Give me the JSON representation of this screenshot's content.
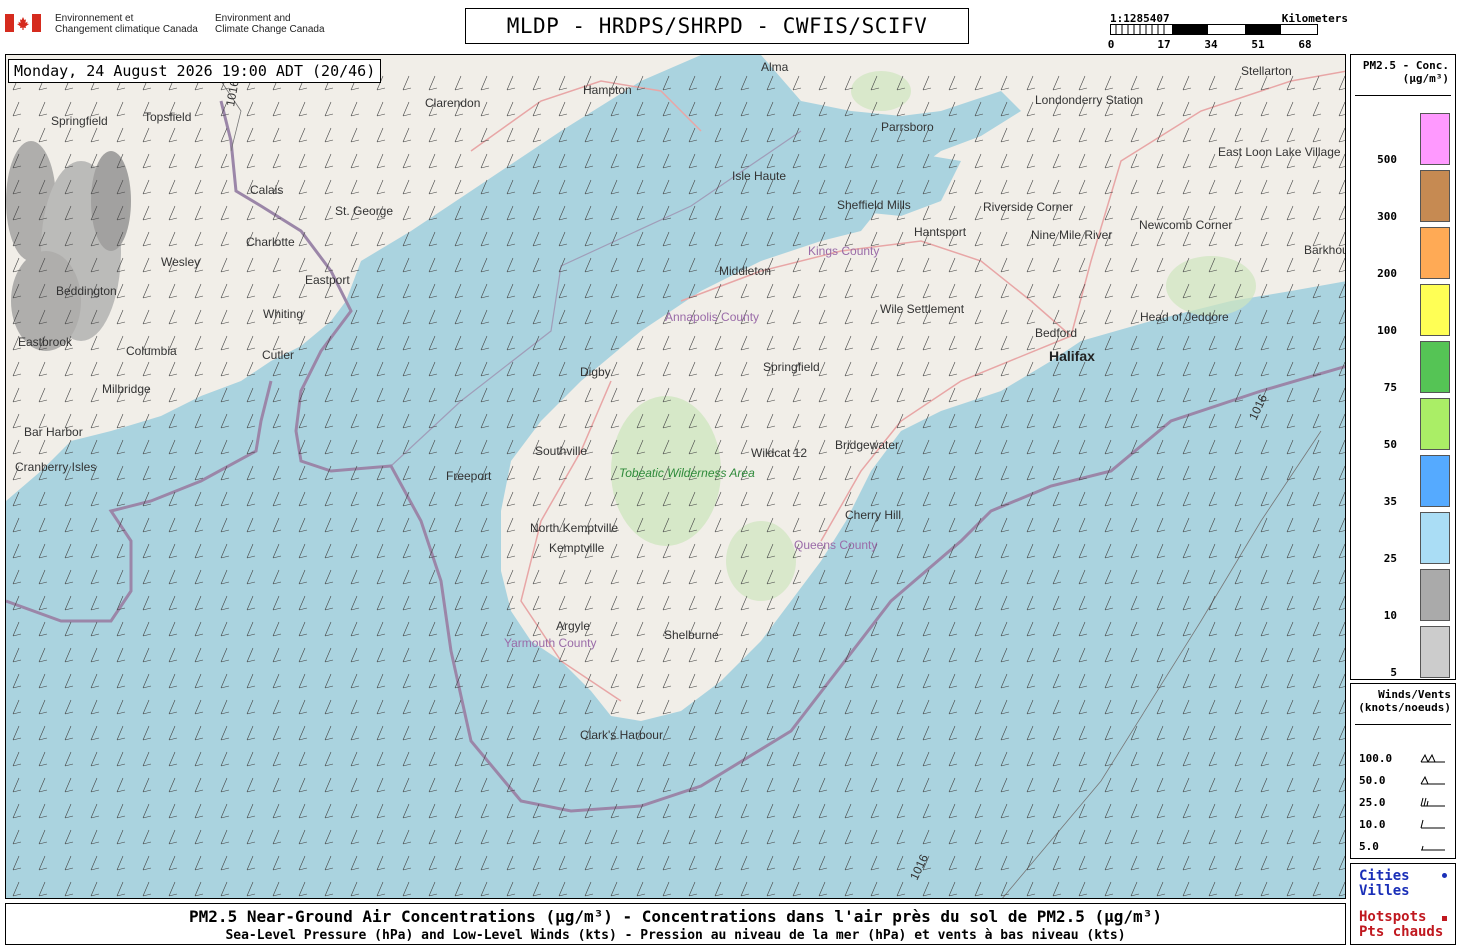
{
  "header": {
    "gov_fr_line1": "Environnement et",
    "gov_fr_line2": "Changement climatique Canada",
    "gov_en_line1": "Environment and",
    "gov_en_line2": "Climate Change Canada",
    "title": "MLDP - HRDPS/SHRPD - CWFIS/SCIFV"
  },
  "scale_bar": {
    "ratio": "1:1285407",
    "units": "Kilometers",
    "ticks": [
      "0",
      "17",
      "34",
      "51",
      "68"
    ]
  },
  "map": {
    "timestamp": "Monday, 24 August 2026 19:00 ADT (20/46)",
    "colors": {
      "water": "#aad3df",
      "land": "#f1eee8",
      "forest": "#cfe6bf",
      "border": "#9b86a8",
      "road": "#e8a6a6",
      "smoke": "#888888"
    },
    "places": [
      {
        "name": "Alma",
        "type": "town"
      },
      {
        "name": "Stellarton",
        "type": "town"
      },
      {
        "name": "Hampton",
        "type": "town"
      },
      {
        "name": "Clarendon",
        "type": "town"
      },
      {
        "name": "Londonderry Station",
        "type": "town"
      },
      {
        "name": "Springfield",
        "type": "town"
      },
      {
        "name": "Topsfield",
        "type": "town"
      },
      {
        "name": "Parrsboro",
        "type": "town"
      },
      {
        "name": "East Loon Lake Village",
        "type": "town"
      },
      {
        "name": "Isle Haute",
        "type": "town"
      },
      {
        "name": "Calais",
        "type": "town"
      },
      {
        "name": "St. George",
        "type": "town"
      },
      {
        "name": "Sheffield Mills",
        "type": "town"
      },
      {
        "name": "Riverside Corner",
        "type": "town"
      },
      {
        "name": "Hantsport",
        "type": "town"
      },
      {
        "name": "Newcomb Corner",
        "type": "town"
      },
      {
        "name": "Charlotte",
        "type": "town"
      },
      {
        "name": "Nine Mile River",
        "type": "town"
      },
      {
        "name": "Kings County",
        "type": "county"
      },
      {
        "name": "Wesley",
        "type": "town"
      },
      {
        "name": "Barkhouse Settlement",
        "type": "town"
      },
      {
        "name": "Middleton",
        "type": "town"
      },
      {
        "name": "Eastport",
        "type": "town"
      },
      {
        "name": "Beddington",
        "type": "town"
      },
      {
        "name": "Whiting",
        "type": "town"
      },
      {
        "name": "Wile Settlement",
        "type": "town"
      },
      {
        "name": "Head of Jeddore",
        "type": "town"
      },
      {
        "name": "Annapolis County",
        "type": "county"
      },
      {
        "name": "Bedford",
        "type": "town"
      },
      {
        "name": "Eastbrook",
        "type": "town"
      },
      {
        "name": "Columbia",
        "type": "town"
      },
      {
        "name": "Cutler",
        "type": "town"
      },
      {
        "name": "Halifax",
        "type": "city"
      },
      {
        "name": "Digby",
        "type": "town"
      },
      {
        "name": "Springfield",
        "type": "town"
      },
      {
        "name": "Milbridge",
        "type": "town"
      },
      {
        "name": "Bar Harbor",
        "type": "town"
      },
      {
        "name": "Bridgewater",
        "type": "town"
      },
      {
        "name": "Wildcat 12",
        "type": "town"
      },
      {
        "name": "Southville",
        "type": "town"
      },
      {
        "name": "Cranberry Isles",
        "type": "town"
      },
      {
        "name": "Freeport",
        "type": "town"
      },
      {
        "name": "Tobeatic Wilderness Area",
        "type": "park"
      },
      {
        "name": "Cherry Hill",
        "type": "town"
      },
      {
        "name": "North Kemptville",
        "type": "town"
      },
      {
        "name": "Kemptville",
        "type": "town"
      },
      {
        "name": "Queens County",
        "type": "county"
      },
      {
        "name": "Argyle",
        "type": "town"
      },
      {
        "name": "Yarmouth County",
        "type": "county"
      },
      {
        "name": "Shelburne",
        "type": "town"
      },
      {
        "name": "Clark's Harbour",
        "type": "town"
      }
    ],
    "isobar_labels": [
      "1016",
      "1016",
      "1016"
    ]
  },
  "pm_legend": {
    "title_line1": "PM2.5 - Conc.",
    "title_line2": "(µg/m³)",
    "levels": [
      {
        "label": "500",
        "color": "#ff99ff"
      },
      {
        "label": "300",
        "color": "#c68a52"
      },
      {
        "label": "200",
        "color": "#ffaa55"
      },
      {
        "label": "100",
        "color": "#ffff55"
      },
      {
        "label": "75",
        "color": "#55c455"
      },
      {
        "label": "50",
        "color": "#aaee66"
      },
      {
        "label": "35",
        "color": "#55aaff"
      },
      {
        "label": "25",
        "color": "#aaddf5"
      },
      {
        "label": "10",
        "color": "#aaaaaa"
      },
      {
        "label": "5",
        "color": "#cccccc"
      }
    ]
  },
  "wind_legend": {
    "title_line1": "Winds/Vents",
    "title_line2": "(knots/noeuds)",
    "rows": [
      "100.0",
      "50.0",
      "25.0",
      "10.0",
      "5.0"
    ]
  },
  "markers_legend": {
    "cities_en": "Cities",
    "cities_fr": "Villes",
    "hotspots_en": "Hotspots",
    "hotspots_fr": "Pts chauds"
  },
  "footer": {
    "line1": "PM2.5 Near-Ground Air Concentrations (µg/m³) - Concentrations dans l'air près du sol de PM2.5 (µg/m³)",
    "line2": "Sea-Level Pressure (hPa) and Low-Level Winds (kts) - Pression au niveau de la mer (hPa) et vents à bas niveau (kts)"
  }
}
